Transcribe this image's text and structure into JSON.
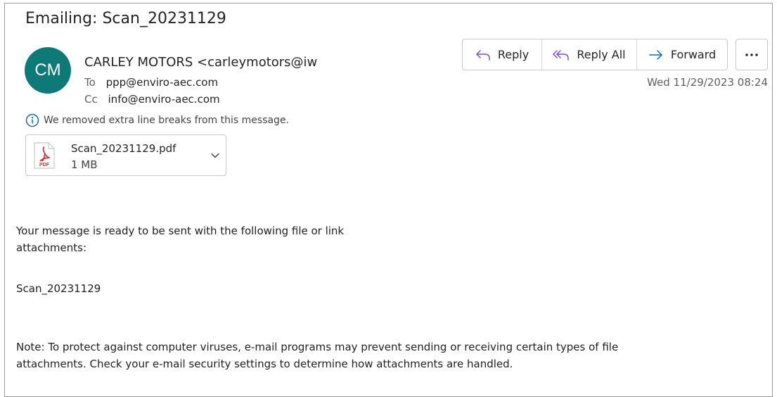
{
  "email": {
    "subject": "Emailing: Scan_20231129",
    "avatar_initials": "CM",
    "avatar_color": "#0e7a78",
    "sender": "CARLEY MOTORS <carleymotors@iw",
    "to_label": "To",
    "to_value": "ppp@enviro-aec.com",
    "cc_label": "Cc",
    "cc_value": "info@enviro-aec.com",
    "date": "Wed 11/29/2023 08:24",
    "info_notice": "We removed extra line breaks from this message."
  },
  "attachment": {
    "name": "Scan_20231129.pdf",
    "size": "1 MB",
    "icon": "pdf-file-icon"
  },
  "actions": {
    "reply": "Reply",
    "reply_all": "Reply All",
    "forward": "Forward",
    "more": "more-options-icon"
  },
  "body": {
    "para1_line1": "Your message is ready to be sent with the following file or link",
    "para1_line2": "attachments:",
    "para2": "Scan_20231129",
    "para3_line1": "Note: To protect against computer viruses, e-mail programs may prevent sending or receiving certain types of file",
    "para3_line2": "attachments.  Check your e-mail security settings to determine how attachments are handled."
  },
  "colors": {
    "accent": "#0f6cbd",
    "pdf_red": "#d13438"
  }
}
